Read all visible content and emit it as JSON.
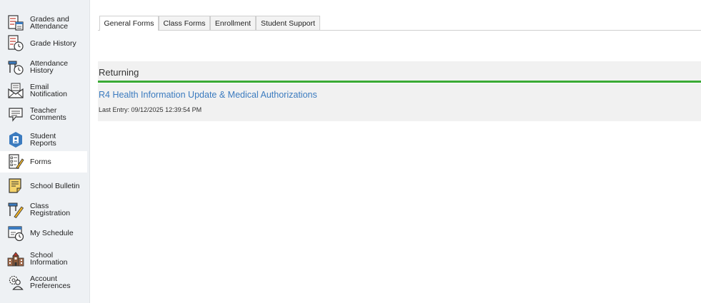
{
  "sidebar": {
    "items": [
      {
        "label": "Grades and\nAttendance",
        "icon": "grades-attendance-icon"
      },
      {
        "label": "Grade History",
        "icon": "grade-history-icon"
      },
      {
        "label": "Attendance\nHistory",
        "icon": "attendance-history-icon"
      },
      {
        "label": "Email\nNotification",
        "icon": "email-icon"
      },
      {
        "label": "Teacher\nComments",
        "icon": "comment-icon"
      },
      {
        "label": "Student\nReports",
        "icon": "student-reports-icon"
      },
      {
        "label": "Forms",
        "icon": "forms-icon",
        "active": true
      },
      {
        "label": "School Bulletin",
        "icon": "bulletin-icon"
      },
      {
        "label": "Class\nRegistration",
        "icon": "class-registration-icon"
      },
      {
        "label": "My Schedule",
        "icon": "schedule-icon"
      },
      {
        "label": "School\nInformation",
        "icon": "school-icon"
      },
      {
        "label": "Account\nPreferences",
        "icon": "account-preferences-icon"
      }
    ]
  },
  "tabs": [
    {
      "label": "General Forms",
      "active": true
    },
    {
      "label": "Class Forms"
    },
    {
      "label": "Enrollment"
    },
    {
      "label": "Student Support"
    }
  ],
  "section": {
    "title": "Returning",
    "accent_color": "#3aaa35"
  },
  "form": {
    "title": "R4 Health Information Update & Medical Authorizations",
    "last_entry": "Last Entry: 09/12/2025 12:39:54 PM",
    "link_color": "#3b7bbf"
  }
}
